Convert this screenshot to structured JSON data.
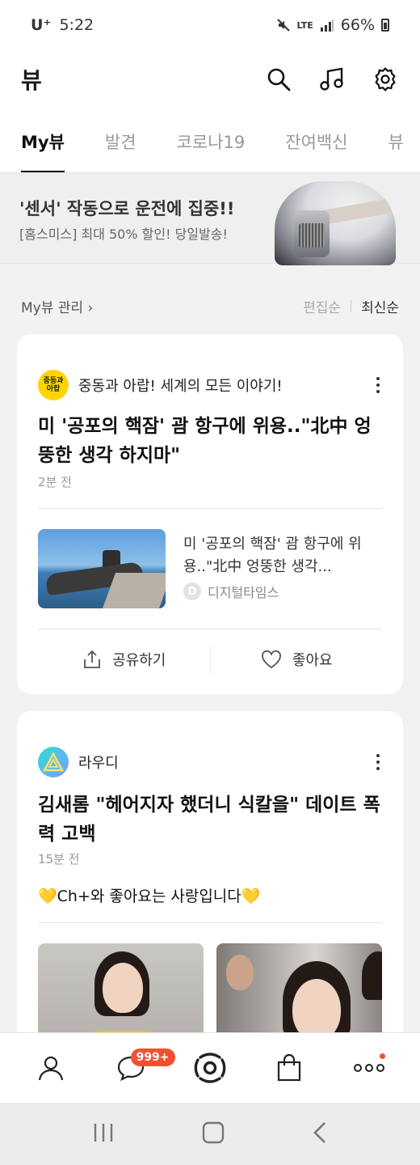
{
  "status_bar": {
    "carrier": "U⁺",
    "time": "5:22",
    "network": "LTE",
    "battery": "66%"
  },
  "header": {
    "title": "뷰"
  },
  "tabs": [
    {
      "label": "My뷰",
      "active": true
    },
    {
      "label": "발견",
      "active": false
    },
    {
      "label": "코로나19",
      "active": false
    },
    {
      "label": "잔여백신",
      "active": false
    },
    {
      "label": "뷰",
      "active": false
    }
  ],
  "ad": {
    "title": "'센서' 작동으로 운전에 집중!!",
    "subtitle": "[홈스미스] 최대 50% 할인! 당일발송!"
  },
  "sort": {
    "manage": "My뷰 관리",
    "edit": "편집순",
    "latest": "최신순"
  },
  "cards": [
    {
      "source_logo_text": "중동과\n아랍",
      "source": "중동과 아랍! 세계의 모든 이야기!",
      "headline": "미 '공포의 핵잠' 괌 항구에 위용..\"北中 엉뚱한 생각 하지마\"",
      "time": "2분 전",
      "related": {
        "text": "미 '공포의 핵잠' 괌 항구에 위용..\"北中 엉뚱한 생각...",
        "source_icon": "D",
        "source": "디지털타임스"
      },
      "share_label": "공유하기",
      "like_label": "좋아요"
    },
    {
      "source": "라우디",
      "headline": "김새롬 \"헤어지자 했더니 식칼을\" 데이트 폭력 고백",
      "time": "15분 전",
      "subtext": "💛Ch+와 좋아요는 사랑입니다💛"
    }
  ],
  "bottom_nav": {
    "chat_badge": "999+"
  },
  "colors": {
    "accent": "#f2512f",
    "yellow_logo": "#ffd400"
  }
}
